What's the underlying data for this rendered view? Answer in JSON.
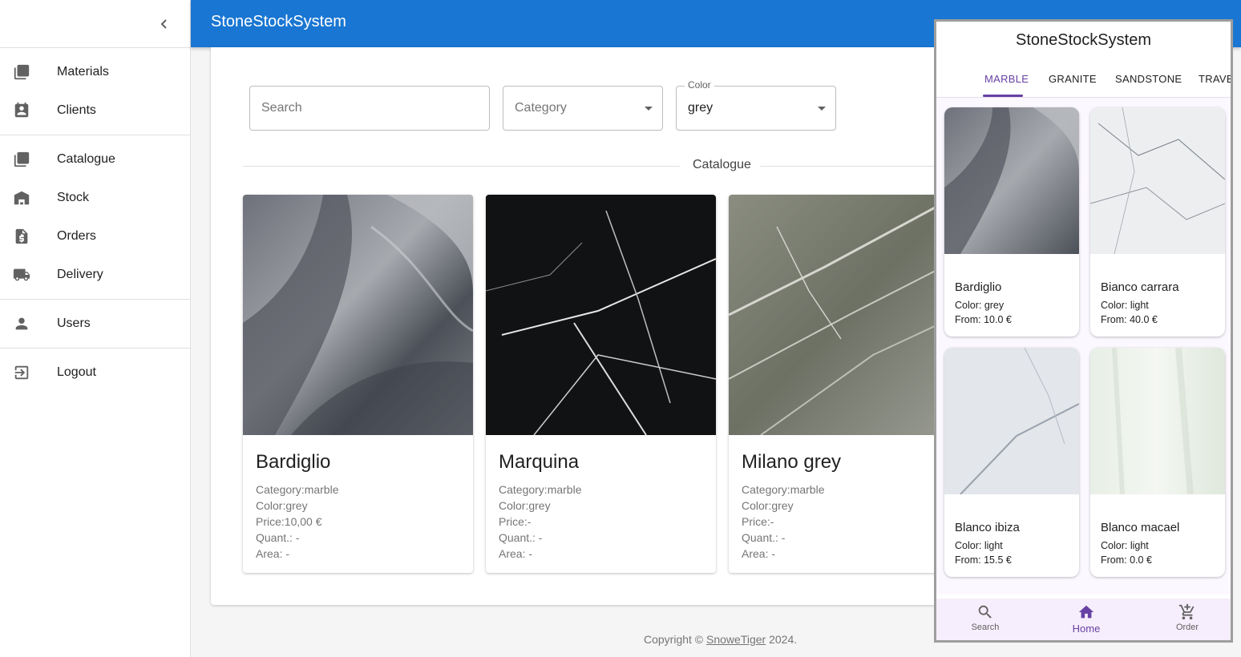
{
  "app": {
    "title": "StoneStockSystem"
  },
  "sidebar": {
    "group1": [
      {
        "label": "Materials",
        "icon": "image-icon"
      },
      {
        "label": "Clients",
        "icon": "contact-icon"
      }
    ],
    "group2": [
      {
        "label": "Catalogue",
        "icon": "image-icon"
      },
      {
        "label": "Stock",
        "icon": "warehouse-icon"
      },
      {
        "label": "Orders",
        "icon": "invoice-icon"
      },
      {
        "label": "Delivery",
        "icon": "truck-icon"
      }
    ],
    "group3": [
      {
        "label": "Users",
        "icon": "person-icon"
      }
    ],
    "group4": [
      {
        "label": "Logout",
        "icon": "logout-icon"
      }
    ]
  },
  "filters": {
    "search_placeholder": "Search",
    "category_placeholder": "Category",
    "color_label": "Color",
    "color_value": "grey"
  },
  "catalogue": {
    "heading": "Catalogue",
    "cards": [
      {
        "name": "Bardiglio",
        "category": "Category:marble",
        "color": "Color:grey",
        "price": "Price:10,00 €",
        "quant": "Quant.: -",
        "area": "Area: -"
      },
      {
        "name": "Marquina",
        "category": "Category:marble",
        "color": "Color:grey",
        "price": "Price:-",
        "quant": "Quant.: -",
        "area": "Area: -"
      },
      {
        "name": "Milano grey",
        "category": "Category:marble",
        "color": "Color:grey",
        "price": "Price:-",
        "quant": "Quant.: -",
        "area": "Area: -"
      }
    ]
  },
  "footer": {
    "prefix": "Copyright © ",
    "link": "SnoweTiger",
    "suffix": " 2024."
  },
  "mobile": {
    "title": "StoneStockSystem",
    "tabs": [
      "MARBLE",
      "GRANITE",
      "SANDSTONE",
      "TRAVE"
    ],
    "cards": [
      {
        "name": "Bardiglio",
        "color": "Color: grey",
        "from": "From: 10.0 €"
      },
      {
        "name": "Bianco carrara",
        "color": "Color: light",
        "from": "From: 40.0 €"
      },
      {
        "name": "Blanco ibiza",
        "color": "Color: light",
        "from": "From: 15.5 €"
      },
      {
        "name": "Blanco macael",
        "color": "Color: light",
        "from": "From: 0.0 €"
      }
    ],
    "bottom_nav": {
      "search": "Search",
      "home": "Home",
      "order": "Order"
    }
  },
  "colors": {
    "primary": "#1976d2",
    "mobile_accent": "#6741a3"
  }
}
